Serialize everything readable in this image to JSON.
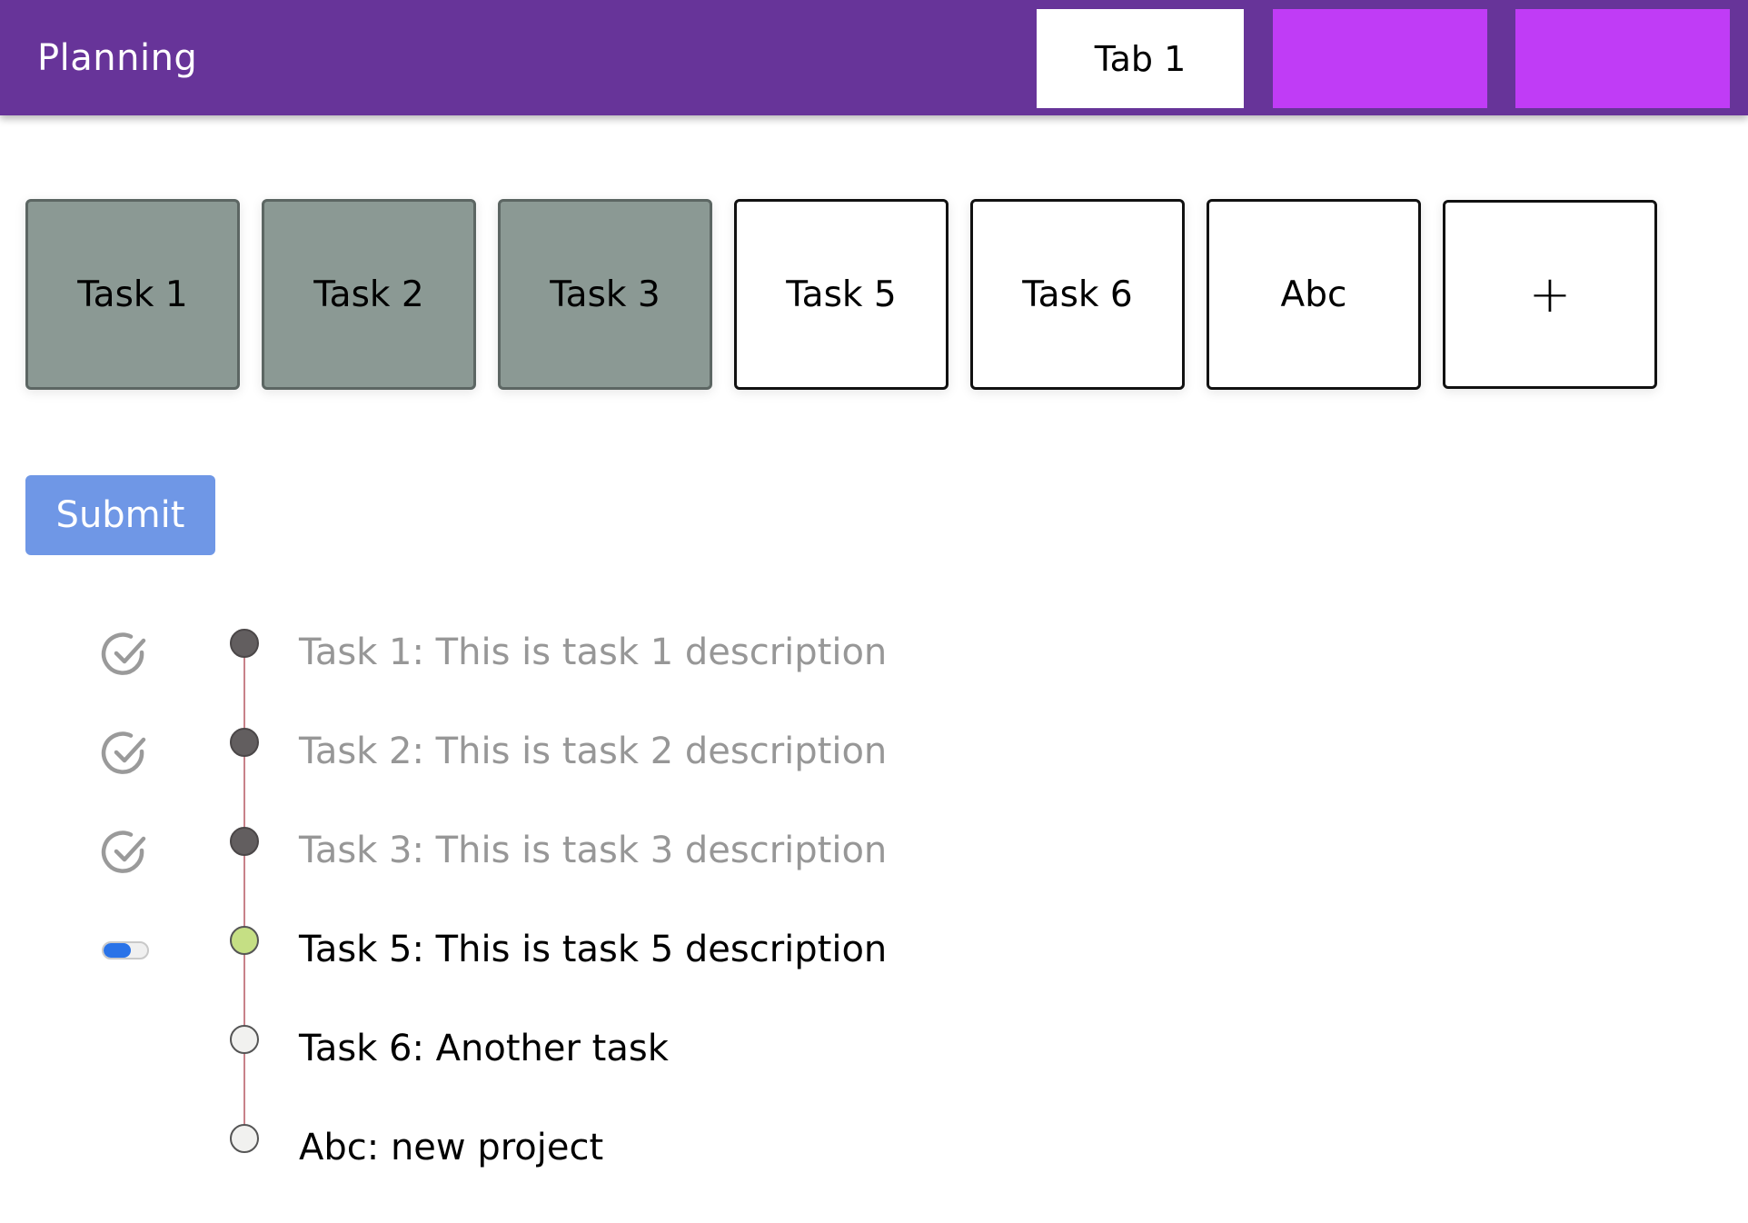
{
  "header": {
    "title": "Planning",
    "tabs": [
      {
        "label": "Tab 1",
        "active": true
      },
      {
        "label": "",
        "active": false
      },
      {
        "label": "",
        "active": false
      }
    ]
  },
  "colors": {
    "header_bg": "#673499",
    "tab_inactive": "#c03cf6",
    "card_done": "#8b9994",
    "submit_bg": "#6f97e6",
    "dot_current": "#c5df84",
    "timeline_line": "#c8828a"
  },
  "task_cards": [
    {
      "label": "Task 1",
      "state": "done"
    },
    {
      "label": "Task 2",
      "state": "done"
    },
    {
      "label": "Task 3",
      "state": "done"
    },
    {
      "label": "Task 5",
      "state": "todo"
    },
    {
      "label": "Task 6",
      "state": "todo"
    },
    {
      "label": "Abc",
      "state": "todo"
    },
    {
      "label": "+",
      "state": "add"
    }
  ],
  "submit": {
    "label": "Submit"
  },
  "timeline": [
    {
      "text": "Task 1: This is task 1 description",
      "status": "done",
      "status_icon": "check-circle-icon"
    },
    {
      "text": "Task 2: This is task 2 description",
      "status": "done",
      "status_icon": "check-circle-icon"
    },
    {
      "text": "Task 3: This is task 3 description",
      "status": "done",
      "status_icon": "check-circle-icon"
    },
    {
      "text": "Task 5: This is task 5 description",
      "status": "current",
      "status_icon": "progress-toggle-icon"
    },
    {
      "text": "Task 6: Another task",
      "status": "pending",
      "status_icon": ""
    },
    {
      "text": "Abc: new project",
      "status": "pending",
      "status_icon": ""
    }
  ]
}
